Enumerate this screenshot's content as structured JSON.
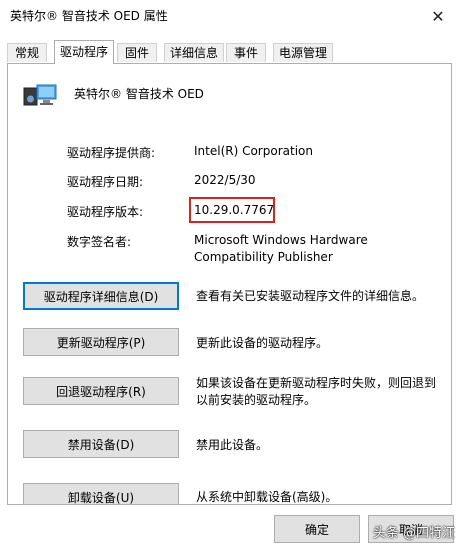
{
  "window": {
    "title": "英特尔® 智音技术 OED 属性",
    "close_glyph": "✕"
  },
  "tabs": [
    {
      "label": "常规",
      "active": false
    },
    {
      "label": "驱动程序",
      "active": true
    },
    {
      "label": "固件",
      "active": false
    },
    {
      "label": "详细信息",
      "active": false
    },
    {
      "label": "事件",
      "active": false
    },
    {
      "label": "电源管理",
      "active": false
    }
  ],
  "device": {
    "name": "英特尔® 智音技术 OED",
    "icon": "speaker-device-icon"
  },
  "properties": {
    "provider_label": "驱动程序提供商:",
    "provider_value": "Intel(R) Corporation",
    "date_label": "驱动程序日期:",
    "date_value": "2022/5/30",
    "version_label": "驱动程序版本:",
    "version_value": "10.29.0.7767",
    "signer_label": "数字签名者:",
    "signer_value_line1": "Microsoft Windows Hardware",
    "signer_value_line2": "Compatibility Publisher"
  },
  "actions": [
    {
      "label": "驱动程序详细信息(D)",
      "description": "查看有关已安装驱动程序文件的详细信息。"
    },
    {
      "label": "更新驱动程序(P)",
      "description": "更新此设备的驱动程序。"
    },
    {
      "label": "回退驱动程序(R)",
      "description": "如果该设备在更新驱动程序时失败，则回退到以前安装的驱动程序。"
    },
    {
      "label": "禁用设备(D)",
      "description": "禁用此设备。"
    },
    {
      "label": "卸载设备(U)",
      "description": "从系统中卸载设备(高级)。"
    }
  ],
  "footer": {
    "ok_label": "确定",
    "cancel_label": "取消"
  },
  "watermark": "头条 @四特汪",
  "colors": {
    "highlight_box": "#e0201a",
    "focus_border": "#0078d7"
  }
}
